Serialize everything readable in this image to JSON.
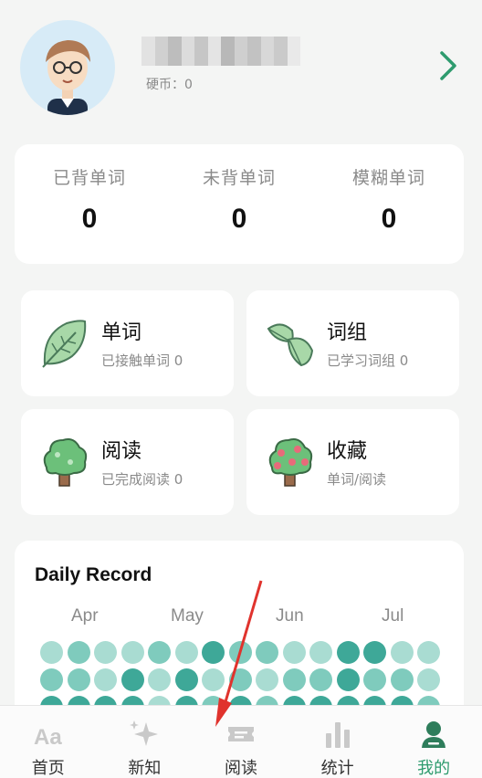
{
  "profile": {
    "coin_label": "硬币：0",
    "avatar_icon": "user-avatar-icon"
  },
  "counts": [
    {
      "label": "已背单词",
      "value": "0"
    },
    {
      "label": "未背单词",
      "value": "0"
    },
    {
      "label": "模糊单词",
      "value": "0"
    }
  ],
  "cards": {
    "words": {
      "title": "单词",
      "subtitle": "已接触单词 0",
      "icon": "leaf-icon"
    },
    "phrases": {
      "title": "词组",
      "subtitle": "已学习词组 0",
      "icon": "double-leaf-icon"
    },
    "reading": {
      "title": "阅读",
      "subtitle": "已完成阅读 0",
      "icon": "tree-icon"
    },
    "favorites": {
      "title": "收藏",
      "subtitle": "单词/阅读",
      "icon": "fruit-tree-icon"
    }
  },
  "record": {
    "title": "Daily Record",
    "months": [
      "Apr",
      "May",
      "Jun",
      "Jul"
    ],
    "levels": [
      [
        1,
        2,
        1,
        1,
        2,
        1,
        3,
        2,
        2,
        1,
        1,
        3,
        3,
        1,
        1
      ],
      [
        2,
        2,
        1,
        3,
        1,
        3,
        1,
        2,
        1,
        2,
        2,
        3,
        2,
        2,
        1
      ],
      [
        3,
        3,
        3,
        3,
        1,
        3,
        2,
        3,
        2,
        3,
        3,
        3,
        3,
        3,
        2
      ]
    ],
    "colors": [
      "#dcefeb",
      "#a9dcd2",
      "#7fcbbd",
      "#3ea898"
    ]
  },
  "tabs": [
    {
      "label": "首页",
      "icon": "aa-text-icon"
    },
    {
      "label": "新知",
      "icon": "sparkle-icon"
    },
    {
      "label": "阅读",
      "icon": "ticket-icon"
    },
    {
      "label": "统计",
      "icon": "bar-chart-icon"
    },
    {
      "label": "我的",
      "icon": "person-icon"
    }
  ],
  "colors": {
    "accent": "#2e9b6e",
    "annotation": "#e0332d"
  }
}
